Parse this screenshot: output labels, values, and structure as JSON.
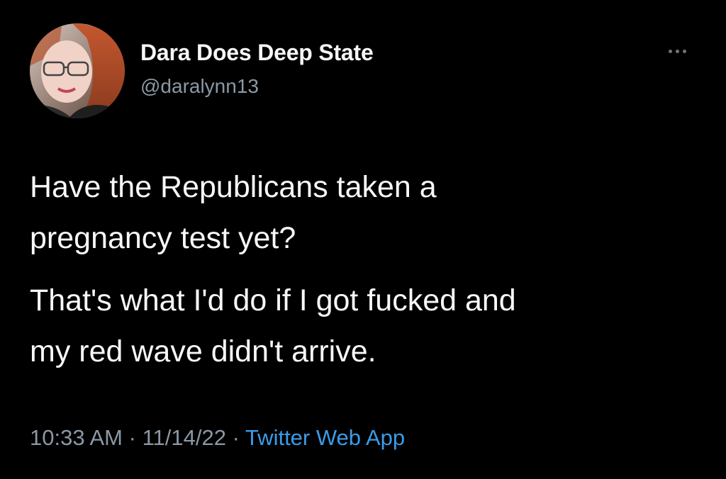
{
  "user": {
    "display_name": "Dara Does Deep State",
    "handle": "@daralynn13"
  },
  "tweet": {
    "paragraphs": [
      "Have the Republicans taken a",
      "pregnancy test yet?",
      "That's what I'd do if I got fucked and",
      "my red wave didn't arrive."
    ],
    "time": "10:33 AM",
    "separator": "·",
    "date": "11/14/22",
    "source": "Twitter Web App"
  },
  "icons": {
    "more": "more-options-icon",
    "avatar": "profile-photo"
  },
  "colors": {
    "background": "#000000",
    "text": "#f7f9f9",
    "secondary_text": "#8b98a5",
    "link": "#3b9be8"
  }
}
